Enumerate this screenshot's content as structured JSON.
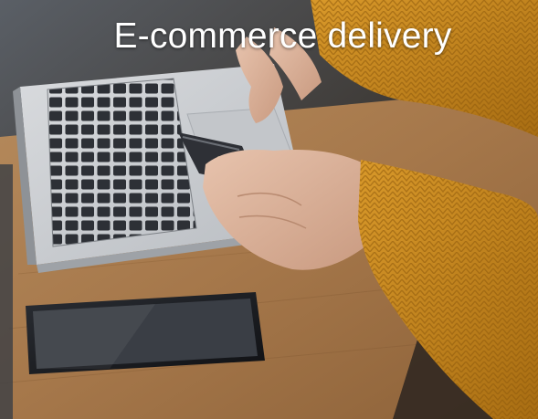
{
  "caption": {
    "text": "E-commerce delivery",
    "color": "#ffffff"
  },
  "photo": {
    "subjects": [
      "laptop-keyboard",
      "credit-card",
      "hands",
      "mustard-sweater",
      "smartphone",
      "wooden-table"
    ],
    "colors": {
      "wood": "#a87a4e",
      "sweater": "#c8891f",
      "laptop": "#c9ccd0",
      "phone": "#1b1d21"
    }
  }
}
